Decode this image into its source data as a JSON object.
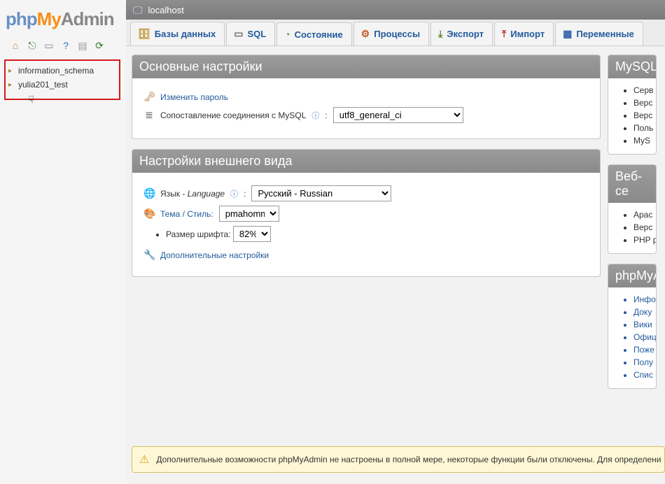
{
  "logo": {
    "a": "php",
    "b": "My",
    "c": "Admin"
  },
  "breadcrumb": {
    "server": "localhost"
  },
  "databases": [
    {
      "name": "information_schema"
    },
    {
      "name": "yulia201_test"
    }
  ],
  "tabs": [
    {
      "id": "db",
      "label": "Базы данных"
    },
    {
      "id": "sql",
      "label": "SQL"
    },
    {
      "id": "status",
      "label": "Состояние"
    },
    {
      "id": "proc",
      "label": "Процессы"
    },
    {
      "id": "export",
      "label": "Экспорт"
    },
    {
      "id": "import",
      "label": "Импорт"
    },
    {
      "id": "vars",
      "label": "Переменные"
    }
  ],
  "panel_main": {
    "title": "Основные настройки",
    "change_password": "Изменить пароль",
    "collation_label": "Сопоставление соединения с MySQL",
    "collation_value": "utf8_general_ci"
  },
  "panel_appearance": {
    "title": "Настройки внешнего вида",
    "language_label_ru": "Язык - ",
    "language_label_en": "Language",
    "language_value": "Русский - Russian",
    "theme_label": "Тема / Стиль:",
    "theme_value": "pmahomme",
    "fontsize_label": "Размер шрифта:",
    "fontsize_value": "82%",
    "more_settings": "Дополнительные настройки"
  },
  "side_mysql": {
    "title": "MySQL",
    "items": [
      "Серв",
      "Верс",
      "Верс",
      "Поль",
      "MyS"
    ]
  },
  "side_web": {
    "title": "Веб-се",
    "items": [
      "Apac",
      "Верс",
      "PHP р"
    ]
  },
  "side_pma": {
    "title": "phpMyA",
    "items": [
      "Инфо",
      "Доку",
      "Вики",
      "Офиц",
      "Поже",
      "Полу",
      "Спис"
    ]
  },
  "notice": "Дополнительные возможности phpMyAdmin не настроены в полной мере, некоторые функции были отключены. Для определени"
}
